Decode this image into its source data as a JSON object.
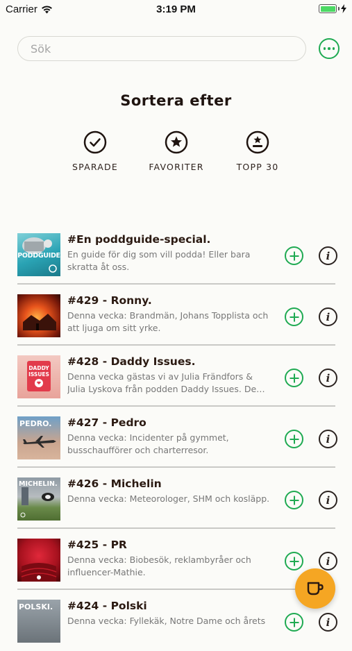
{
  "status_bar": {
    "carrier": "Carrier",
    "time": "3:19 PM",
    "battery_color": "#4cd964"
  },
  "search": {
    "placeholder": "Sök",
    "value": ""
  },
  "more_icon": "more-horizontal-icon",
  "sort": {
    "title": "Sortera efter",
    "options": [
      {
        "label": "SPARADE",
        "icon": "check-circle-icon"
      },
      {
        "label": "FAVORITER",
        "icon": "star-circle-icon"
      },
      {
        "label": "TOPP 30",
        "icon": "award-circle-icon"
      }
    ]
  },
  "episodes": [
    {
      "title": "#En poddguide-special.",
      "description": "En guide för dig som vill podda! Eller bara skratta åt oss.",
      "thumb_text": "PODDGUIDE"
    },
    {
      "title": "#429 - Ronny.",
      "description": "Denna vecka: Brandmän, Johans Topplista och att ljuga om sitt yrke.",
      "thumb_text": ""
    },
    {
      "title": "#428 - Daddy Issues.",
      "description": "Denna vecka gästas vi av Julia Frändfors & Julia Lyskova från podden Daddy Issues. De…",
      "thumb_text": "DADDY ISSUES"
    },
    {
      "title": "#427 - Pedro",
      "description": "Denna vecka: Incidenter på gymmet, busschaufförer och charterresor.",
      "thumb_text": "PEDRO."
    },
    {
      "title": "#426 - Michelin",
      "description": "Denna vecka: Meteorologer, SHM och kosläpp.",
      "thumb_text": "MICHELIN."
    },
    {
      "title": "#425 - PR",
      "description": "Denna vecka: Biobesök, reklambyråer och influencer-Mathie.",
      "thumb_text": ""
    },
    {
      "title": "#424 - Polski",
      "description": "Denna vecka: Fyllekäk, Notre Dame och årets",
      "thumb_text": "POLSKI."
    }
  ],
  "colors": {
    "accent_green": "#1faa52",
    "fab_orange": "#f5a623"
  },
  "fab_icon": "coffee-cup-icon"
}
